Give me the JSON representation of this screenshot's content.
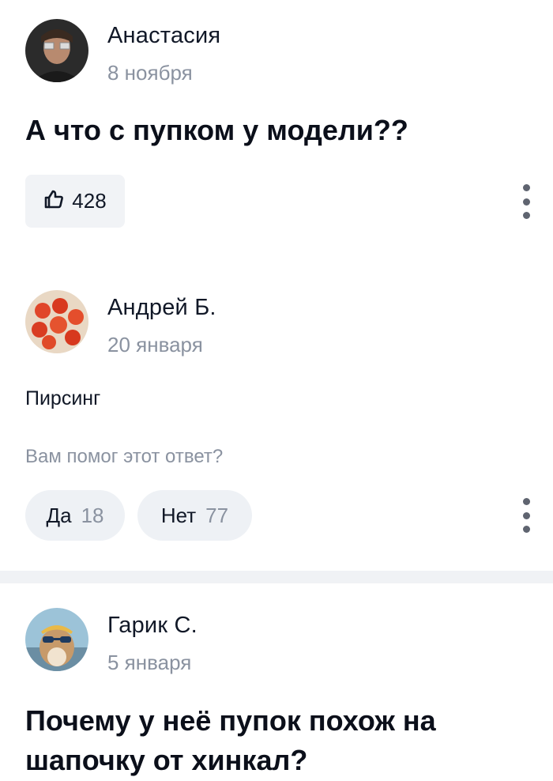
{
  "question_post": {
    "author": "Анастасия",
    "date": "8 ноября",
    "text": "А что с пупком у модели??",
    "likes": "428",
    "like_icon": "thumbs-up-icon",
    "more_icon": "kebab-menu-icon"
  },
  "answer": {
    "author": "Андрей Б.",
    "date": "20 января",
    "text": "Пирсинг",
    "helped_prompt": "Вам помог этот ответ?",
    "yes_label": "Да",
    "yes_count": "18",
    "no_label": "Нет",
    "no_count": "77",
    "more_icon": "kebab-menu-icon"
  },
  "next_post": {
    "author": "Гарик С.",
    "date": "5 января",
    "text": "Почему у неё пупок похож на шапочку от хинкал?"
  },
  "colors": {
    "text": "#0b0f1a",
    "muted": "#8a92a0",
    "button_bg": "#eef1f5",
    "divider": "#f0f2f5"
  }
}
